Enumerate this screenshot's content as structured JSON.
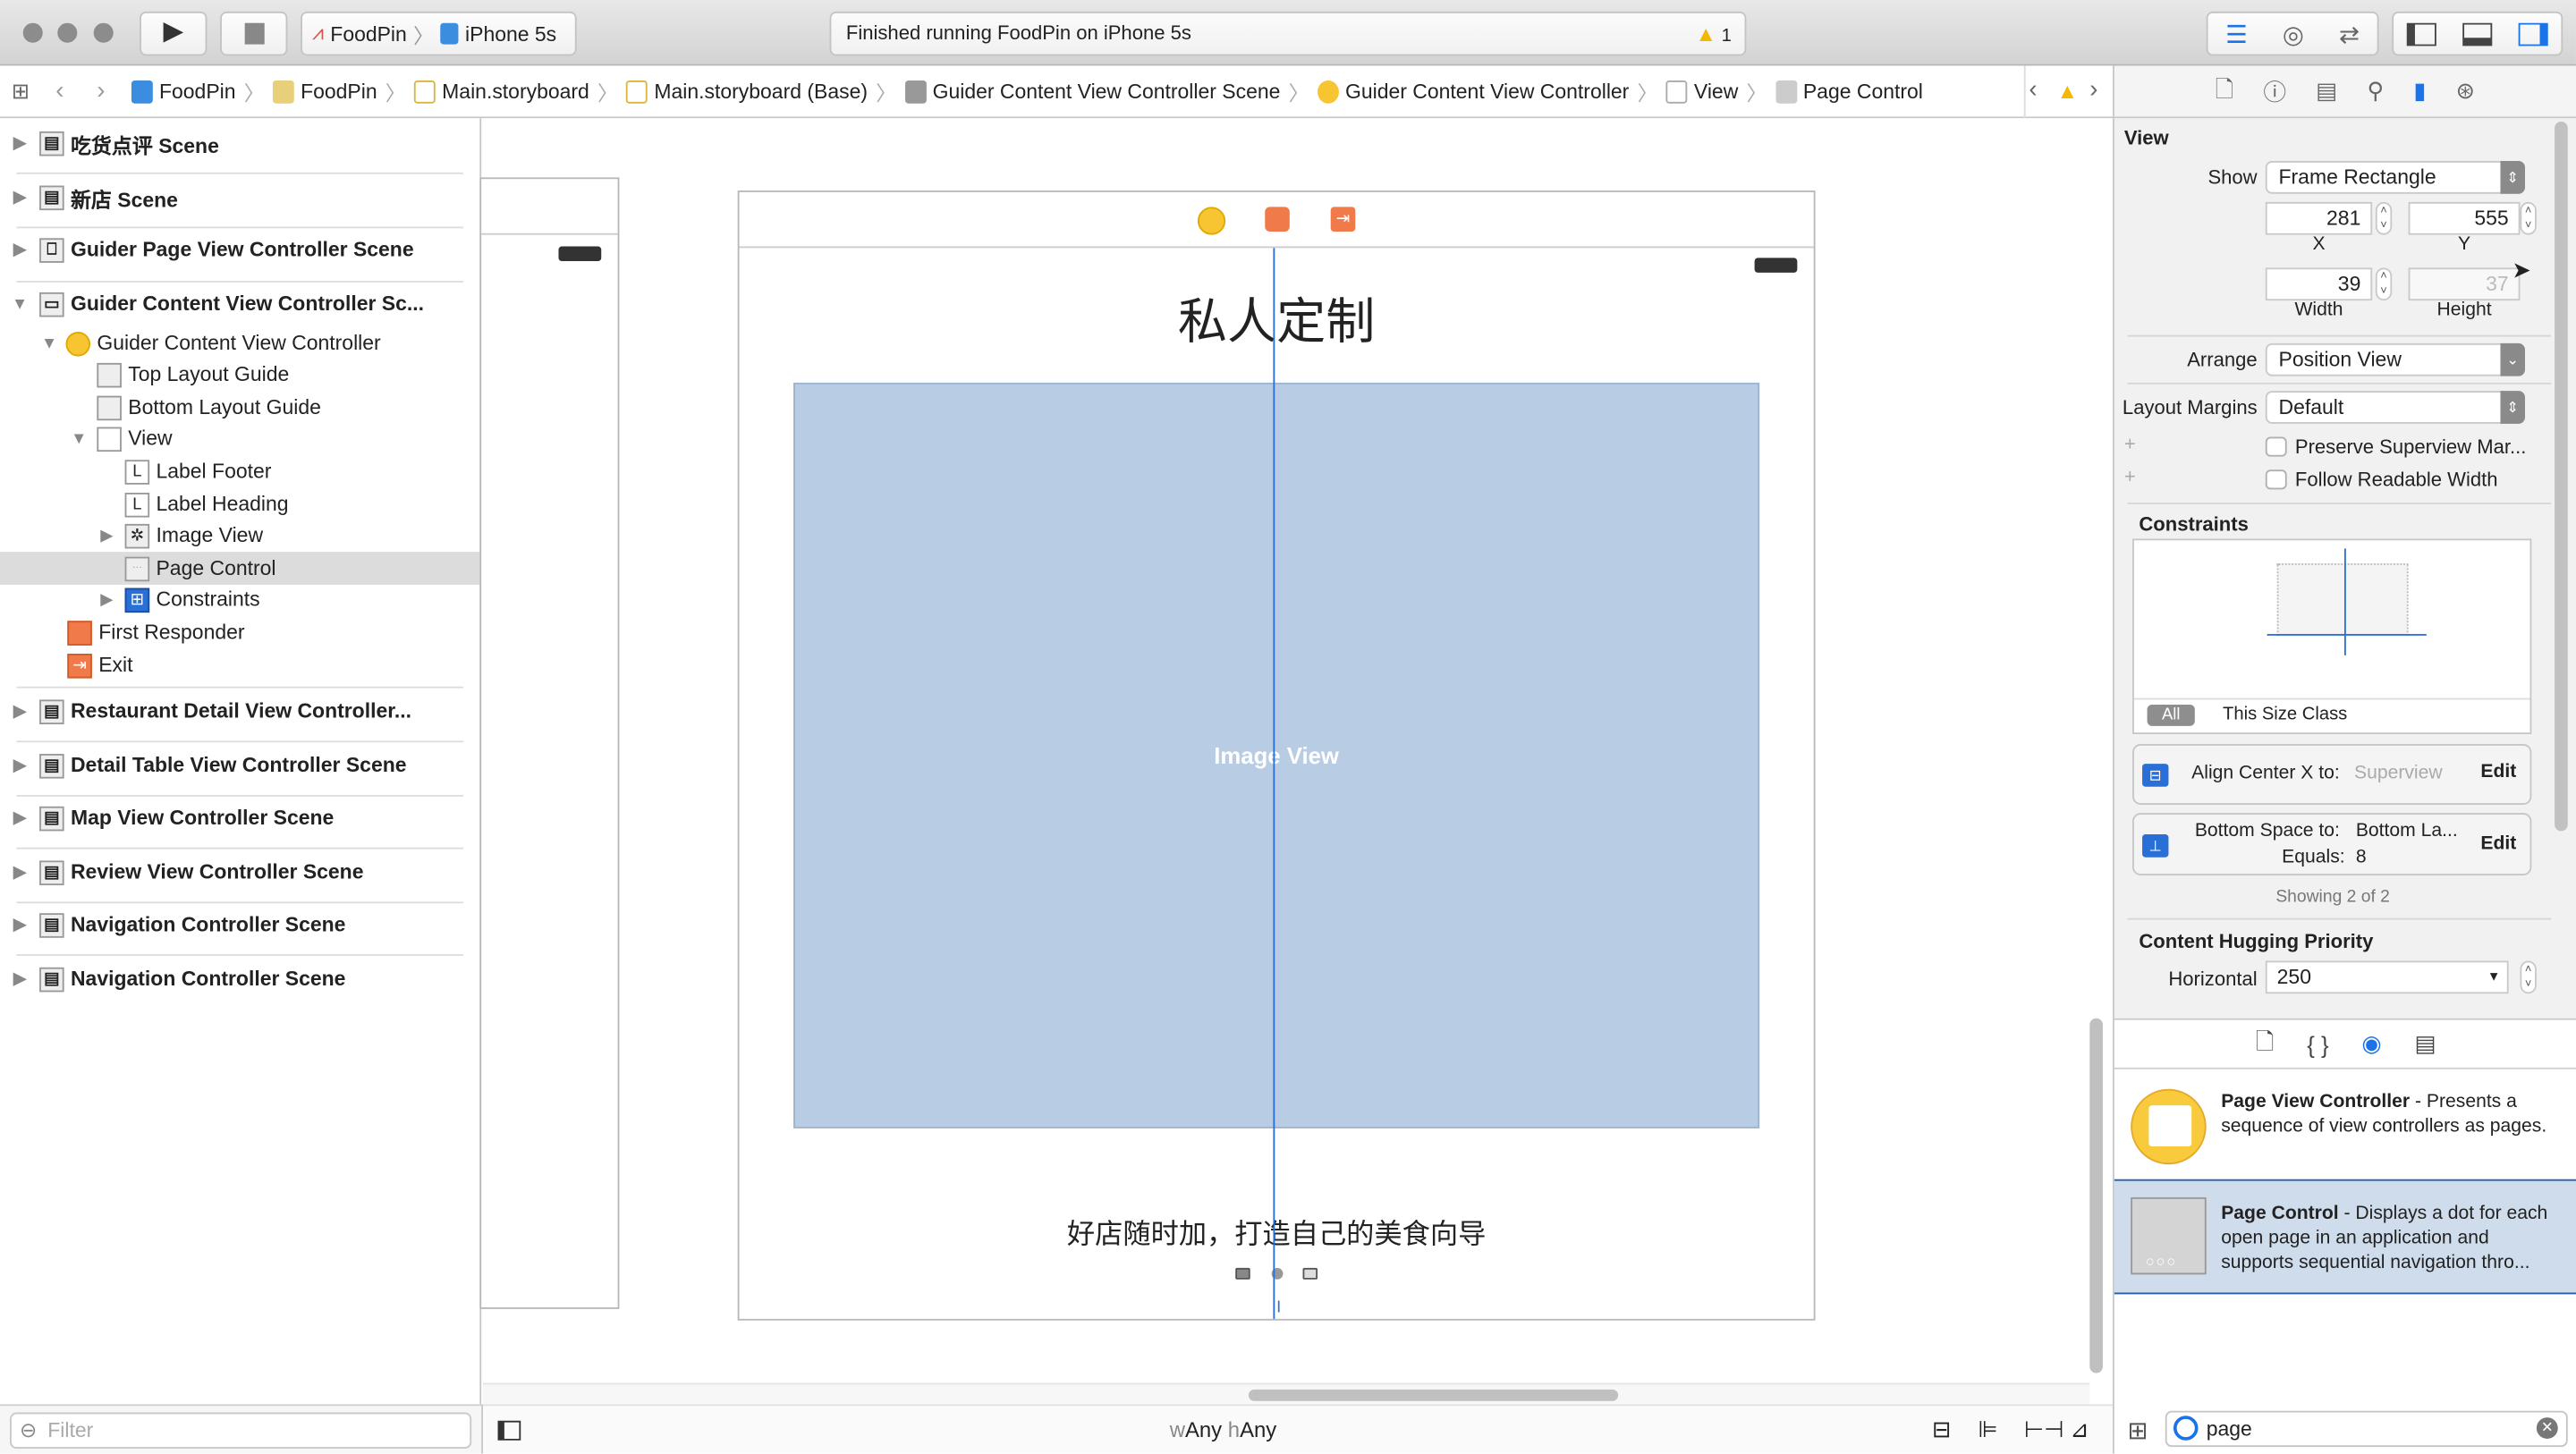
{
  "toolbar": {
    "scheme": "FoodPin",
    "device": "iPhone 5s",
    "status": "Finished running FoodPin on iPhone 5s",
    "warning_count": "1"
  },
  "jumpbar": {
    "crumbs": [
      "FoodPin",
      "FoodPin",
      "Main.storyboard",
      "Main.storyboard (Base)",
      "Guider Content View Controller Scene",
      "Guider Content View Controller",
      "View",
      "Page Control"
    ]
  },
  "navigator": {
    "scenes_top": [
      "吃货点评 Scene",
      "新店 Scene",
      "Guider Page View Controller Scene",
      "Guider Content View Controller Sc..."
    ],
    "tree": {
      "controller": "Guider Content View Controller",
      "top_layout_guide": "Top Layout Guide",
      "bottom_layout_guide": "Bottom Layout Guide",
      "view": "View",
      "label_footer": "Label Footer",
      "label_heading": "Label Heading",
      "image_view": "Image View",
      "page_control": "Page Control",
      "constraints": "Constraints",
      "first_responder": "First Responder",
      "exit": "Exit",
      "label_glyph": "L"
    },
    "scenes_bottom": [
      "Restaurant Detail View Controller...",
      "Detail Table View Controller Scene",
      "Map View Controller Scene",
      "Review View Controller Scene",
      "Navigation Controller Scene",
      "Navigation Controller Scene"
    ],
    "filter_placeholder": "Filter"
  },
  "canvas": {
    "heading": "私人定制",
    "image_view_label": "Image View",
    "footer": "好店随时加，打造自己的美食向导",
    "size_class": {
      "w": "w",
      "w_value": "Any",
      "h": "h",
      "h_value": "Any"
    }
  },
  "inspector": {
    "section": "View",
    "show_label": "Show",
    "show_value": "Frame Rectangle",
    "x": "281",
    "x_label": "X",
    "y": "555",
    "y_label": "Y",
    "width": "39",
    "width_label": "Width",
    "height": "37",
    "height_label": "Height",
    "arrange_label": "Arrange",
    "arrange_value": "Position View",
    "margins_label": "Layout Margins",
    "margins_value": "Default",
    "preserve": "Preserve Superview Mar...",
    "readable": "Follow Readable Width",
    "constraints_title": "Constraints",
    "all_btn": "All",
    "size_class_btn": "This Size Class",
    "c1_label": "Align Center X to:",
    "c1_target": "Superview",
    "c2_label": "Bottom Space to:",
    "c2_target": "Bottom La...",
    "c2_eq_label": "Equals:",
    "c2_eq": "8",
    "edit": "Edit",
    "showing": "Showing 2 of 2",
    "hugging_title": "Content Hugging Priority",
    "horizontal_label": "Horizontal",
    "horizontal_value": "250"
  },
  "library": {
    "items": [
      {
        "title": "Page View Controller",
        "desc": " - Presents a sequence of view controllers as pages."
      },
      {
        "title": "Page Control",
        "desc": " - Displays a dot for each open page in an application and supports sequential navigation thro..."
      }
    ],
    "search": "page"
  },
  "colors": {
    "accent": "#1a73e8",
    "image_view": "#b8cce4",
    "selection": "#cfdcec",
    "warning": "#f5b800"
  }
}
